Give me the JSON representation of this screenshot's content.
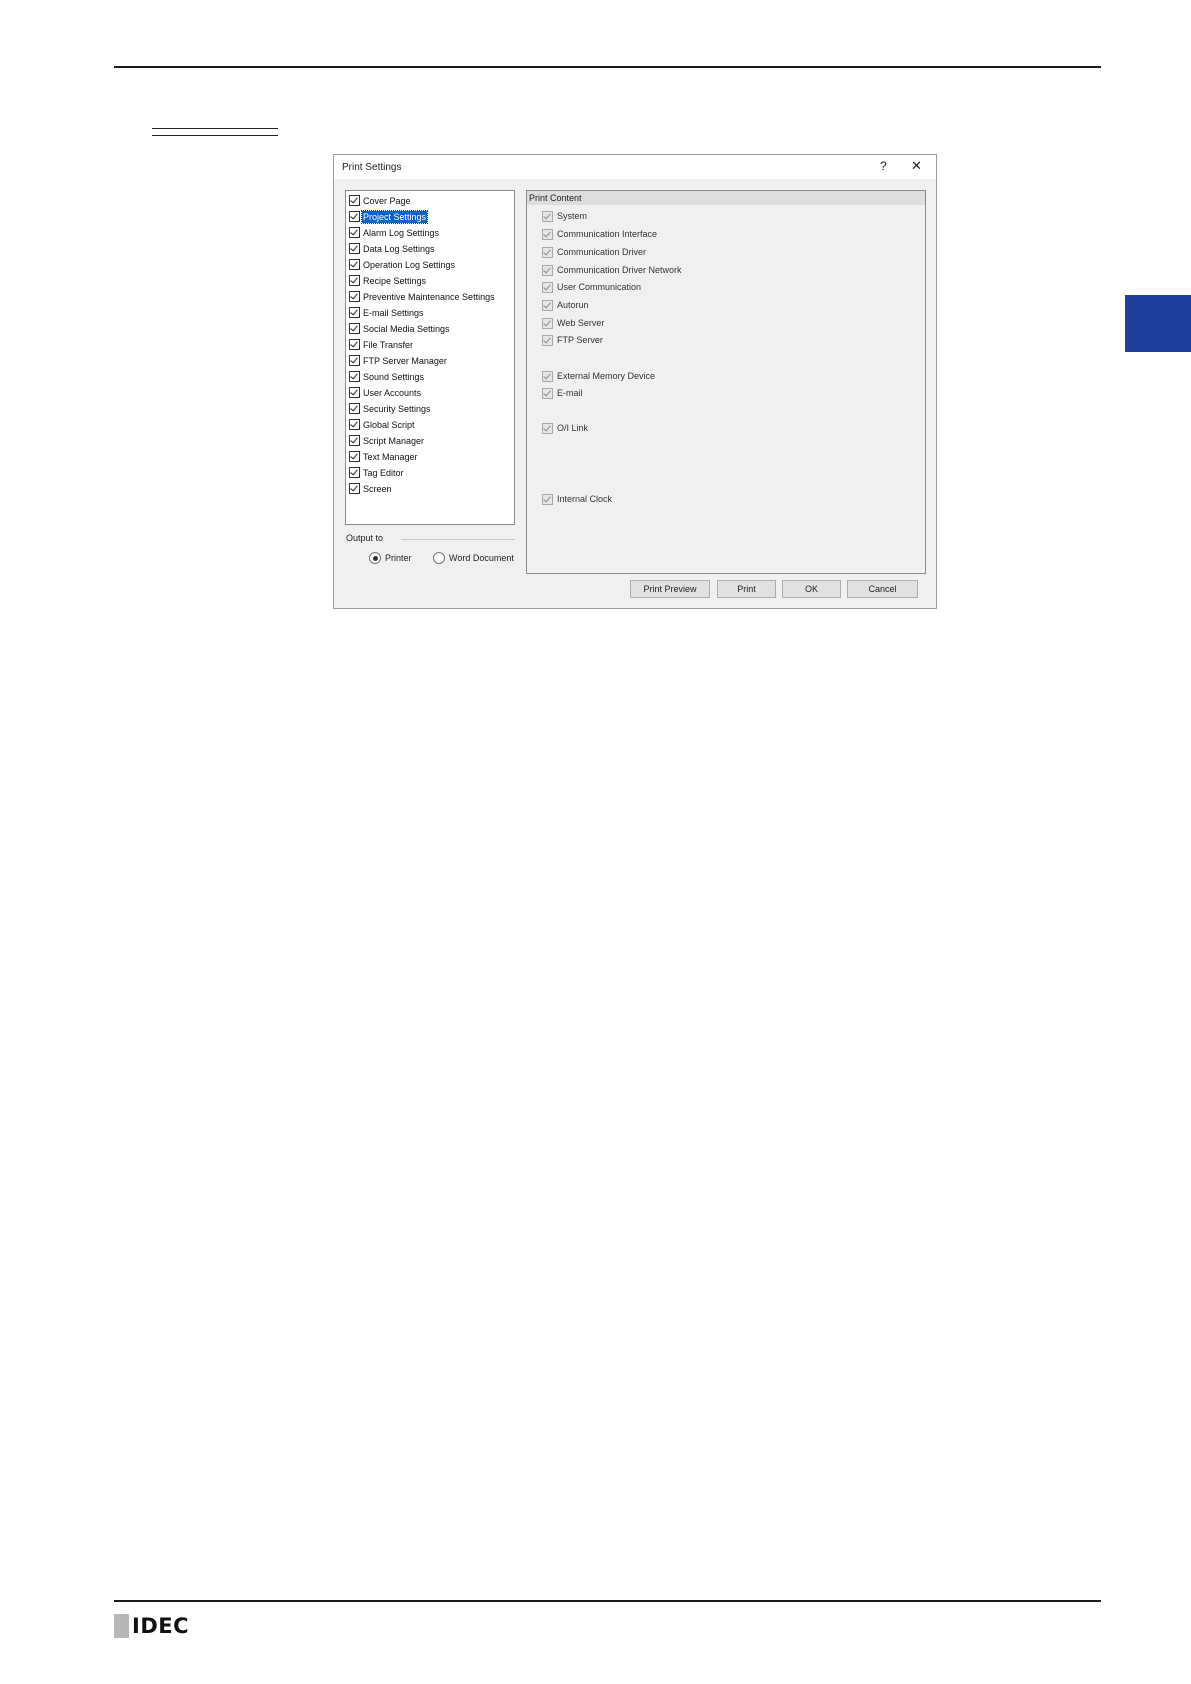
{
  "footer": {
    "brand": "IDEC"
  },
  "dialog": {
    "title": "Print Settings",
    "help_label": "?",
    "close_label": "✕",
    "tree": [
      {
        "label": "Cover Page",
        "checked": true,
        "selected": false
      },
      {
        "label": "Project Settings",
        "checked": true,
        "selected": true
      },
      {
        "label": "Alarm Log Settings",
        "checked": true,
        "selected": false
      },
      {
        "label": "Data Log Settings",
        "checked": true,
        "selected": false
      },
      {
        "label": "Operation Log Settings",
        "checked": true,
        "selected": false
      },
      {
        "label": "Recipe Settings",
        "checked": true,
        "selected": false
      },
      {
        "label": "Preventive Maintenance Settings",
        "checked": true,
        "selected": false
      },
      {
        "label": "E-mail Settings",
        "checked": true,
        "selected": false
      },
      {
        "label": "Social Media Settings",
        "checked": true,
        "selected": false
      },
      {
        "label": "File Transfer",
        "checked": true,
        "selected": false
      },
      {
        "label": "FTP Server Manager",
        "checked": true,
        "selected": false
      },
      {
        "label": "Sound Settings",
        "checked": true,
        "selected": false
      },
      {
        "label": "User Accounts",
        "checked": true,
        "selected": false
      },
      {
        "label": "Security Settings",
        "checked": true,
        "selected": false
      },
      {
        "label": "Global Script",
        "checked": true,
        "selected": false
      },
      {
        "label": "Script Manager",
        "checked": true,
        "selected": false
      },
      {
        "label": "Text Manager",
        "checked": true,
        "selected": false
      },
      {
        "label": "Tag Editor",
        "checked": true,
        "selected": false
      },
      {
        "label": "Screen",
        "checked": true,
        "selected": false
      }
    ],
    "output": {
      "label": "Output to",
      "options": [
        {
          "label": "Printer",
          "selected": true
        },
        {
          "label": "Word Document",
          "selected": false
        }
      ]
    },
    "print_content": {
      "title": "Print Content",
      "items": [
        {
          "label": "System",
          "checked": true,
          "enabled": false
        },
        {
          "label": "Communication Interface",
          "checked": true,
          "enabled": false
        },
        {
          "label": "Communication Driver",
          "checked": true,
          "enabled": false
        },
        {
          "label": "Communication Driver Network",
          "checked": true,
          "enabled": false
        },
        {
          "label": "User Communication",
          "checked": true,
          "enabled": false
        },
        {
          "label": "Autorun",
          "checked": true,
          "enabled": false
        },
        {
          "label": "Web Server",
          "checked": true,
          "enabled": false
        },
        {
          "label": "FTP Server",
          "checked": true,
          "enabled": false
        },
        {
          "label": "External Memory Device",
          "checked": true,
          "enabled": false
        },
        {
          "label": "E-mail",
          "checked": true,
          "enabled": false
        },
        {
          "label": "O/I Link",
          "checked": true,
          "enabled": false
        },
        {
          "label": "Internal Clock",
          "checked": true,
          "enabled": false
        }
      ]
    },
    "buttons": {
      "print_preview": "Print Preview",
      "print": "Print",
      "ok": "OK",
      "cancel": "Cancel"
    }
  }
}
